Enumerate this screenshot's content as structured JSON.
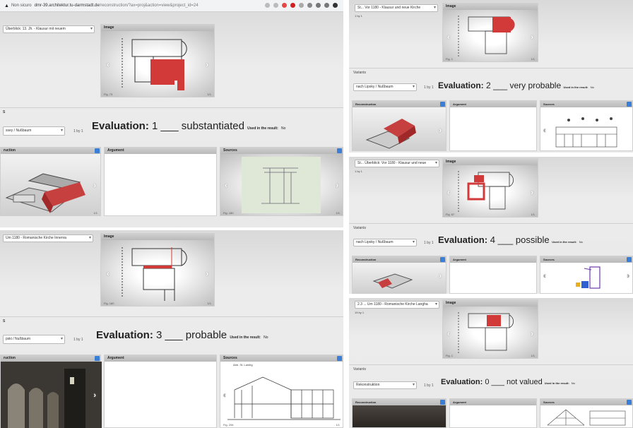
{
  "browser": {
    "tab_label": "Non sicuro",
    "url_host": "dmr-39.architektur.tu-darmstadt.de",
    "url_path": "/reconstruction/?ax=proj&action=view&project_id=24"
  },
  "common": {
    "image": "Image",
    "reconstruction": "Reconstruction",
    "reconstruction_cut": "ruction",
    "argument": "Argument",
    "sources": "Sources",
    "variants": "Variants",
    "used": "Used in the result:",
    "no": "No",
    "by": "1 by 1",
    "blank": "___"
  },
  "left1": {
    "select": "Überblick: 13. Jh. - Klausur mit neuem",
    "fig": "Fig. 73",
    "num": "1/1",
    "section": "S",
    "variant_select": "ssey / Nußbaum",
    "eval_label": "Evaluation:",
    "eval_num": "1",
    "eval_text": "substantiated",
    "rec_fig": "1/1",
    "src_fig": "Fig. 180",
    "src_num": "1/1"
  },
  "left2": {
    "select": "Um 1180 - Romanische Kirche Innenra",
    "fig": "Fig. 180",
    "num": "1/1",
    "section": "S",
    "variant_select": "pski / Nußbaum",
    "eval_label": "Evaluation:",
    "eval_num": "3",
    "eval_text": "probable",
    "src_caption": "Abb. St. Lambg",
    "rec_fig": "1/1",
    "src_fig": "Fig. 206",
    "src_num": "1/1"
  },
  "right1": {
    "select": "St... Vor 1180 - Klausur und neue Kirche",
    "by": "1 by 1",
    "fig": "Fig. 1",
    "num": "1/1",
    "variant_select": "nach Lipsky / Nußbaum",
    "eval_label": "Evaluation:",
    "eval_num": "2",
    "eval_text": "very probable"
  },
  "right2": {
    "select": "St... Überblick: Vor 1180 - Klausur und neue",
    "by": "1 by 1",
    "fig": "Fig. 67",
    "num": "1/1",
    "variant_select": "nach Lipsky / Nußbaum",
    "eval_label": "Evaluation:",
    "eval_num": "4",
    "eval_text": "possible"
  },
  "right3": {
    "select": "2.3 ... Um 1180 - Romanische Kirche Langha",
    "by": "19 by 1",
    "fig": "Fig. 1",
    "num": "1/1",
    "variant_select": "Rekonstruktion",
    "eval_label": "Evaluation:",
    "eval_num": "0",
    "eval_text": "not valued"
  }
}
